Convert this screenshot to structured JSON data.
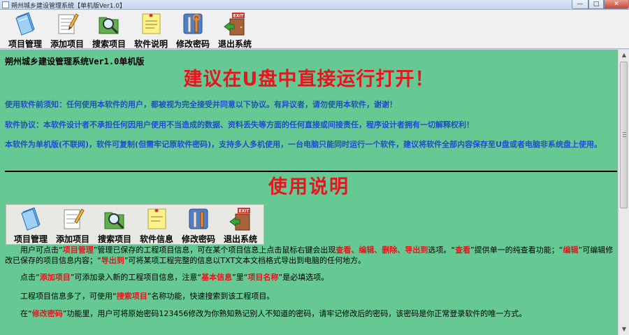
{
  "window": {
    "title": "朔州城乡建设管理系统【单机版Ver1.0】",
    "min_label": "—",
    "max_label": "□",
    "close_label": "✕"
  },
  "toolbar": {
    "items": [
      {
        "label": "项目管理",
        "icon": "notebook-icon"
      },
      {
        "label": "添加项目",
        "icon": "notepad-pencil-icon"
      },
      {
        "label": "搜索项目",
        "icon": "folder-search-icon"
      },
      {
        "label": "软件说明",
        "icon": "sticky-note-icon"
      },
      {
        "label": "修改密码",
        "icon": "tools-icon"
      },
      {
        "label": "退出系统",
        "icon": "exit-door-icon"
      }
    ]
  },
  "content": {
    "app_name": "朔州城乡建设管理系统Ver1.0单机版",
    "warning": "建议在U盘中直接运行打开！",
    "notice": "使用软件前须知：任何使用本软件的用户，都被视为完全接受并同意以下协议。有异议者，请勿使用本软件，谢谢！",
    "agreement": "软件协议：本软件设计者不承担任何因用户使用不当造成的数据、资料丢失等方面的任何直接或间接责任，程序设计者拥有一切解释权利！",
    "standalone": "本软件为单机版(不联网)，软件可复制(但需牢记原软件密码)，支持多人多机使用，一台电脑只能同时运行一个软件，建议将软件全部内容保存至U盘或者电脑非系统盘上使用。",
    "usage_title": "使用说明",
    "shot_items": [
      {
        "label": "项目管理",
        "icon": "notebook-icon"
      },
      {
        "label": "添加项目",
        "icon": "notepad-pencil-icon"
      },
      {
        "label": "搜索项目",
        "icon": "folder-search-icon"
      },
      {
        "label": "软件信息",
        "icon": "sticky-note-icon"
      },
      {
        "label": "修改密码",
        "icon": "tools-icon"
      },
      {
        "label": "退出系统",
        "icon": "exit-door-icon"
      }
    ],
    "p1": {
      "a": "　　用户可点击“",
      "b": "项目管理",
      "c": "”管理已保存的工程项目信息，可在某个项目信息上点击鼠标右键会出现",
      "d": "查看、编辑、删除、导出到",
      "e": "选项。“",
      "f": "查看",
      "g": "”提供单一的纯查看功能；“",
      "h": "编辑",
      "i": "”可编辑修改已保存的项目信息内容；“",
      "j": "导出到",
      "k": "”可将某项工程完整的信息以TXT文本文档格式导出到电脑的任何地方。"
    },
    "p2": {
      "a": "　　点击“",
      "b": "添加项目",
      "c": "”可添加录入新的工程项目信息，注意“",
      "d": "基本信息",
      "e": "”里“",
      "f": "项目名称",
      "g": "”是必填选项。"
    },
    "p3": {
      "a": "　　工程项目信息多了，可使用“",
      "b": "搜索项目",
      "c": "”名称功能，快速搜索到该工程项目。"
    },
    "p4": {
      "a": "　　在“",
      "b": "修改密码",
      "c": "”功能里，用户可将原始密码123456修改为你熟知熟记别人不知道的密码，请牢记修改后的密码，该密码是你正常登录软件的唯一方式。"
    }
  },
  "icons": {
    "exit_sign": "EXIT"
  },
  "colors": {
    "content_bg": "#66c994",
    "warning_red": "#e8141e",
    "notice_blue": "#1f4fc8"
  }
}
